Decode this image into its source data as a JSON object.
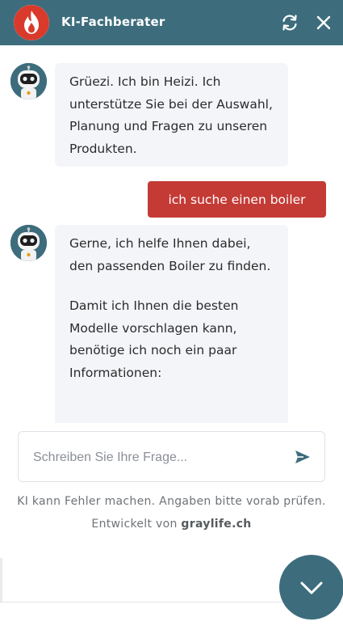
{
  "header": {
    "title": "KI-Fachberater",
    "icons": {
      "logo": "flame-logo-icon",
      "refresh": "refresh-icon",
      "close": "close-icon"
    }
  },
  "messages": [
    {
      "sender": "bot",
      "paragraphs": [
        "Grüezi. Ich bin Heizi. Ich unterstütze Sie bei der Auswahl, Planung und Fragen zu unseren Produkten."
      ]
    },
    {
      "sender": "user",
      "text": "ich suche einen boiler"
    },
    {
      "sender": "bot",
      "paragraphs": [
        "Gerne, ich helfe Ihnen dabei, den passenden Boiler zu finden.",
        "Damit ich Ihnen die besten Modelle vorschlagen kann, benötige ich noch ein paar Informationen:"
      ]
    }
  ],
  "input": {
    "placeholder": "Schreiben Sie Ihre Frage...",
    "value": ""
  },
  "footer": {
    "disclaimer": "KI kann Fehler machen. Angaben bitte vorab prüfen.",
    "credit_prefix": "Entwickelt von",
    "credit_brand": "graylife.ch"
  },
  "colors": {
    "header": "#3d6d7d",
    "user_bubble": "#c43b36",
    "bot_bubble": "#f4f5f9",
    "logo_flame": "#d93a2b"
  },
  "fab_icon": "chevron-down-icon"
}
